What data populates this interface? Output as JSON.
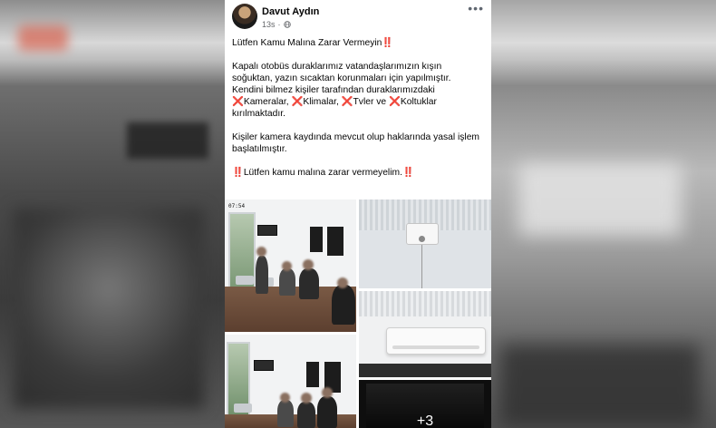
{
  "post": {
    "author": "Davut Aydın",
    "time": "13s",
    "privacy_icon": "globe-icon",
    "menu_icon": "more-options-icon",
    "title": "Lütfen Kamu Malına Zarar Vermeyin",
    "p1_line1": "Kapalı otobüs duraklarımız vatandaşlarımızın kışın",
    "p1_line2": "soğuktan, yazın sıcaktan korunmaları için yapılmıştır.",
    "p1_line3": "Kendini bilmez kişiler tarafından duraklarımızdaki",
    "item1": "Kameralar,",
    "item2": "Klimalar,",
    "item3": "Tvler ve",
    "item4": "Koltuklar",
    "p1_end": "kırılmaktadır.",
    "p2_line1": "Kişiler kamera kaydında mevcut olup haklarında yasal işlem",
    "p2_line2": "başlatılmıştır.",
    "closing": "Lütfen kamu malına zarar vermeyelim.",
    "excl_mark": "‼️",
    "x_mark": "❌"
  },
  "photos": {
    "timestamp": "07:54",
    "more_count": "+3"
  },
  "colors": {
    "accent_red": "#e0243a",
    "text": "#050505",
    "meta": "#65676b"
  }
}
